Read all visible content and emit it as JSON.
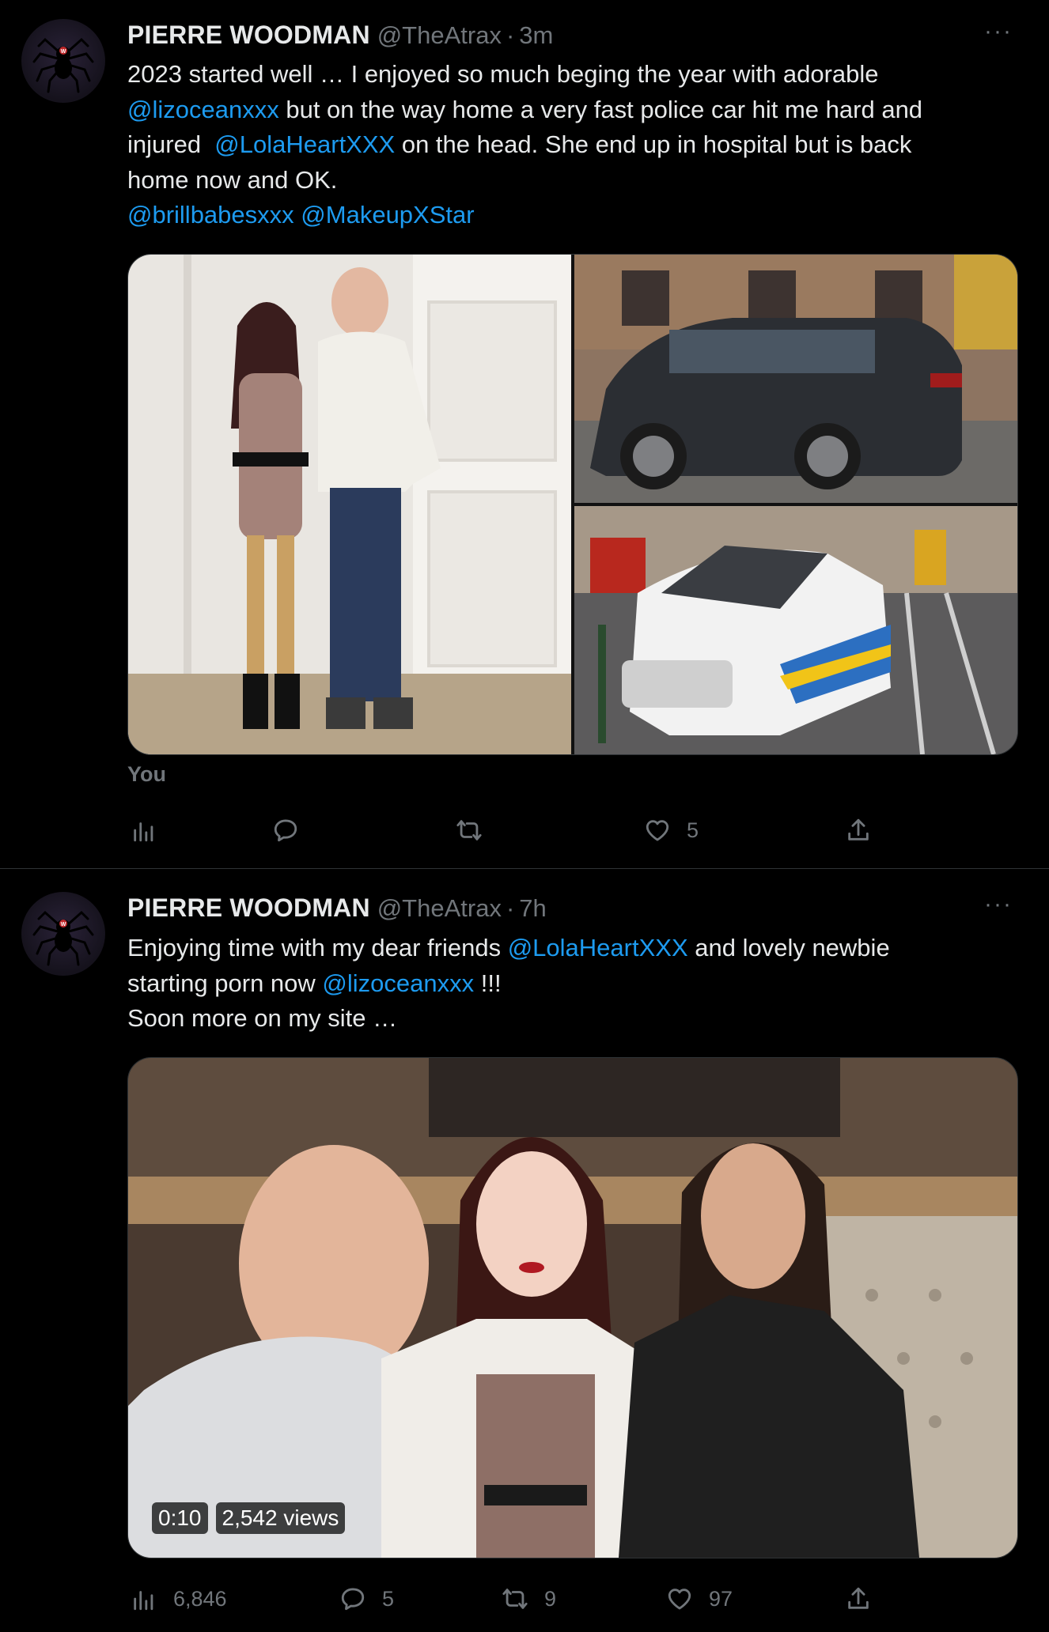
{
  "tweets": [
    {
      "author_name": "PIERRE WOODMAN",
      "author_handle": "@TheAtrax",
      "separator": "·",
      "time": "3m",
      "more_label": "···",
      "text": {
        "line1": "2023 started well … I enjoyed so much beging the year with adorable",
        "m_lizocean": "@lizoceanxxx",
        "line2_rest": " but on the way home a very fast police car hit me hard and",
        "line3_pre": "injured  ",
        "m_lolaheart": "@LolaHeartXXX",
        "line3_rest": " on the head. She end up in hospital but is back",
        "line4": "home now and OK.",
        "m_brill": "@brillbabesxxx",
        "m_makeup": "@MakeupXStar"
      },
      "you_label": "You",
      "actions": {
        "likes": "5"
      }
    },
    {
      "author_name": "PIERRE WOODMAN",
      "author_handle": "@TheAtrax",
      "separator": "·",
      "time": "7h",
      "more_label": "···",
      "text": {
        "line1_pre": "Enjoying time with my dear friends ",
        "m_lolaheart": "@LolaHeartXXX",
        "line1_rest": " and lovely newbie",
        "line2_pre": "starting porn now ",
        "m_lizocean": "@lizoceanxxx",
        "line2_rest": " !!!",
        "line3": "Soon more on my site …"
      },
      "video": {
        "duration": "0:10",
        "views": "2,542 views"
      },
      "actions": {
        "views": "6,846",
        "replies": "5",
        "retweets": "9",
        "likes": "97"
      }
    }
  ],
  "colors": {
    "background": "#000000",
    "text": "#e7e9ea",
    "muted": "#71767b",
    "link": "#1d9bf0",
    "divider": "#2f3336"
  },
  "icons": [
    "analytics-icon",
    "reply-icon",
    "retweet-icon",
    "like-icon",
    "share-icon",
    "more-icon",
    "spider-logo-icon"
  ]
}
